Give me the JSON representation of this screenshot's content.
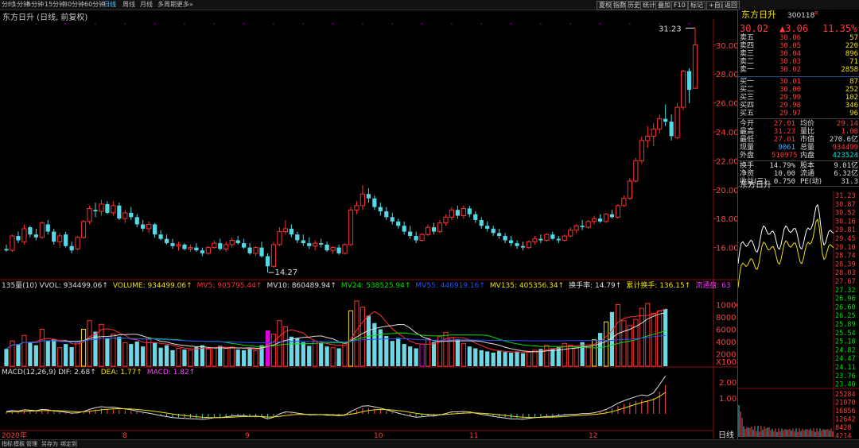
{
  "toolbar": {
    "tabs": [
      "分时",
      "1分钟",
      "5分钟",
      "15分钟",
      "30分钟",
      "60分钟",
      "日线",
      "周线",
      "月线",
      "多周期",
      "更多»"
    ],
    "selected": "日线",
    "right_buttons": [
      "夏权",
      "指数",
      "历史",
      "统计",
      "叠加",
      "F10",
      "标记",
      "+自选",
      "返回"
    ]
  },
  "chart": {
    "title": "东方日升 (日线, 前复权)",
    "max_label": "31.23",
    "min_label": "14.27",
    "price_ticks": [
      "30.00",
      "28.00",
      "26.00",
      "24.00",
      "22.00",
      "20.00",
      "18.00",
      "16.00"
    ],
    "month_labels": [
      "2020年",
      "8",
      "9",
      "10",
      "11",
      "12"
    ],
    "period_label": "日线",
    "vol_unit": "X100",
    "vol_ticks": [
      "10000",
      "8000",
      "6000",
      "4000",
      "2000"
    ],
    "macd_ticks": [
      "2.00",
      "1.00"
    ]
  },
  "vol_info": [
    {
      "text": "135量(10) VVOL: 934499.06↑",
      "color": "#dddddd"
    },
    {
      "text": "VOLUME: 934499.06↑",
      "color": "#f0e000"
    },
    {
      "text": "MV5: 905795.44↑",
      "color": "#ff3030"
    },
    {
      "text": "MV10: 860489.94↑",
      "color": "#dddddd"
    },
    {
      "text": "MV24: 538525.94↑",
      "color": "#00e000"
    },
    {
      "text": "MV55: 446919.16↑",
      "color": "#2050ff"
    },
    {
      "text": "MV135: 405356.34↑",
      "color": "#f0e000"
    },
    {
      "text": "换手率: 14.79↑",
      "color": "#dddddd"
    },
    {
      "text": "累计换手: 136.15↑",
      "color": "#f0e000"
    },
    {
      "text": "流通盘: 63",
      "color": "#ff30ff"
    }
  ],
  "macd_info": [
    {
      "text": "MACD(12,26,9) DIF: 2.68↑",
      "color": "#dddddd"
    },
    {
      "text": "DEA: 1.77↑",
      "color": "#f0e000"
    },
    {
      "text": "MACD: 1.82↑",
      "color": "#ff40ff"
    }
  ],
  "quote": {
    "name": "东方日升",
    "code": "300118",
    "badge": "R",
    "price": "30.02",
    "change": "▲3.06",
    "pct": "11.35%",
    "asks": [
      {
        "label": "卖五",
        "price": "30.06",
        "vol": "57"
      },
      {
        "label": "卖四",
        "price": "30.05",
        "vol": "220"
      },
      {
        "label": "卖三",
        "price": "30.04",
        "vol": "896"
      },
      {
        "label": "卖二",
        "price": "30.03",
        "vol": "71"
      },
      {
        "label": "卖一",
        "price": "30.02",
        "vol": "2858"
      }
    ],
    "bids": [
      {
        "label": "买一",
        "price": "30.01",
        "vol": "87"
      },
      {
        "label": "买二",
        "price": "30.00",
        "vol": "252"
      },
      {
        "label": "买三",
        "price": "29.99",
        "vol": "102"
      },
      {
        "label": "买四",
        "price": "29.98",
        "vol": "346"
      },
      {
        "label": "买五",
        "price": "29.97",
        "vol": "96"
      }
    ],
    "stats": [
      {
        "l1": "今开",
        "v1": "27.01",
        "l2": "均价",
        "v2": "29.14"
      },
      {
        "l1": "最高",
        "v1": "31.23",
        "l2": "量比",
        "v2": "1.08"
      },
      {
        "l1": "最低",
        "v1": "27.01",
        "l2": "市值",
        "v2": "270.6亿"
      },
      {
        "l1": "现量",
        "v1": "9061",
        "l2": "总量",
        "v2": "934499"
      },
      {
        "l1": "外盘",
        "v1": "510975",
        "l2": "内盘",
        "v2": "423524"
      }
    ],
    "stats2": [
      {
        "l1": "换手",
        "v1": "14.79%",
        "l2": "股本",
        "v2": "9.01亿"
      },
      {
        "l1": "净资",
        "v1": "10.00",
        "l2": "流通",
        "v2": "6.32亿"
      },
      {
        "l1": "收益(三)",
        "v1": "0.750",
        "l2": "PE(动)",
        "v2": "31.3"
      }
    ],
    "mini_title": "东方日升",
    "mini_price_ticks": [
      "31.23",
      "30.87",
      "30.52",
      "30.16",
      "29.81",
      "29.45",
      "29.10",
      "28.74",
      "28.39",
      "28.03",
      "27.67",
      "27.32",
      "26.96",
      "26.60",
      "26.25",
      "25.89",
      "25.54",
      "25.18",
      "24.82",
      "24.47",
      "24.11",
      "23.76",
      "23.40"
    ],
    "mini_vol_ticks": [
      "25284",
      "21070",
      "16856",
      "12642",
      "8428",
      "4214"
    ]
  },
  "bottombar": {
    "tabs": [
      "指标",
      "模板",
      "管理",
      "另存为",
      "绑定到"
    ]
  },
  "chart_data": {
    "type": "candlestick",
    "title": "东方日升 (日线, 前复权)",
    "ylim": [
      14.0,
      31.8
    ],
    "months": [
      "2020年",
      "8",
      "9",
      "10",
      "11",
      "12"
    ],
    "ohlc": [
      [
        15.9,
        16.2,
        15.7,
        15.8
      ],
      [
        15.8,
        16.9,
        15.7,
        16.8
      ],
      [
        16.8,
        17.1,
        16.3,
        16.5
      ],
      [
        16.4,
        17.6,
        16.2,
        17.3
      ],
      [
        17.4,
        17.5,
        16.7,
        16.9
      ],
      [
        16.9,
        17.3,
        16.5,
        16.7
      ],
      [
        16.7,
        17.8,
        16.6,
        17.7
      ],
      [
        17.6,
        17.9,
        16.9,
        17.1
      ],
      [
        17.1,
        17.3,
        16.2,
        16.4
      ],
      [
        16.4,
        17.0,
        16.0,
        16.8
      ],
      [
        16.9,
        17.1,
        16.0,
        16.1
      ],
      [
        16.1,
        16.4,
        15.6,
        15.8
      ],
      [
        15.9,
        16.8,
        15.8,
        16.7
      ],
      [
        16.7,
        17.9,
        16.6,
        17.8
      ],
      [
        17.8,
        18.9,
        17.6,
        18.7
      ],
      [
        18.6,
        19.1,
        18.1,
        18.5
      ],
      [
        18.5,
        19.3,
        18.2,
        19.0
      ],
      [
        19.0,
        19.2,
        18.3,
        18.4
      ],
      [
        18.4,
        19.2,
        18.2,
        18.9
      ],
      [
        18.9,
        19.1,
        17.9,
        18.0
      ],
      [
        18.0,
        18.6,
        17.7,
        18.4
      ],
      [
        18.4,
        18.8,
        17.9,
        18.1
      ],
      [
        18.1,
        18.3,
        17.4,
        17.6
      ],
      [
        17.6,
        17.9,
        17.1,
        17.3
      ],
      [
        17.3,
        17.8,
        17.0,
        17.6
      ],
      [
        17.6,
        17.7,
        16.7,
        16.9
      ],
      [
        16.9,
        17.2,
        16.5,
        16.6
      ],
      [
        16.6,
        16.9,
        16.2,
        16.3
      ],
      [
        16.3,
        16.6,
        15.9,
        16.1
      ],
      [
        16.1,
        16.4,
        15.8,
        16.2
      ],
      [
        16.2,
        16.3,
        15.8,
        15.9
      ],
      [
        15.9,
        16.2,
        15.7,
        16.0
      ],
      [
        16.0,
        16.3,
        15.7,
        15.8
      ],
      [
        15.8,
        16.0,
        15.4,
        15.6
      ],
      [
        15.6,
        16.1,
        15.5,
        16.0
      ],
      [
        16.0,
        16.5,
        15.9,
        16.3
      ],
      [
        16.3,
        16.6,
        15.8,
        15.9
      ],
      [
        15.9,
        16.4,
        15.7,
        16.2
      ],
      [
        16.2,
        16.7,
        16.0,
        16.5
      ],
      [
        16.5,
        16.8,
        16.2,
        16.3
      ],
      [
        16.3,
        16.6,
        15.9,
        16.0
      ],
      [
        16.0,
        16.3,
        15.5,
        15.6
      ],
      [
        15.6,
        16.1,
        15.4,
        16.0
      ],
      [
        16.0,
        16.4,
        15.3,
        15.4
      ],
      [
        15.4,
        15.6,
        14.27,
        14.7
      ],
      [
        14.7,
        16.4,
        14.6,
        16.2
      ],
      [
        16.2,
        17.4,
        16.1,
        17.1
      ],
      [
        17.1,
        17.9,
        16.9,
        17.3
      ],
      [
        17.3,
        17.6,
        16.7,
        16.9
      ],
      [
        16.9,
        17.1,
        16.3,
        16.5
      ],
      [
        16.5,
        16.9,
        16.1,
        16.3
      ],
      [
        16.3,
        16.7,
        15.9,
        16.1
      ],
      [
        16.1,
        16.5,
        15.8,
        16.3
      ],
      [
        16.3,
        16.6,
        16.0,
        16.2
      ],
      [
        16.2,
        16.4,
        15.7,
        15.8
      ],
      [
        15.8,
        16.1,
        15.6,
        16.0
      ],
      [
        16.0,
        16.2,
        15.5,
        15.6
      ],
      [
        15.6,
        16.3,
        15.5,
        16.2
      ],
      [
        16.2,
        18.8,
        16.1,
        18.6
      ],
      [
        18.6,
        19.2,
        18.3,
        18.9
      ],
      [
        18.9,
        20.3,
        18.6,
        19.7
      ],
      [
        19.7,
        20.1,
        19.1,
        19.4
      ],
      [
        19.4,
        19.6,
        18.6,
        18.8
      ],
      [
        18.8,
        19.1,
        18.2,
        18.5
      ],
      [
        18.5,
        18.8,
        17.9,
        18.1
      ],
      [
        18.1,
        18.4,
        17.6,
        17.8
      ],
      [
        17.8,
        18.0,
        17.3,
        17.5
      ],
      [
        17.5,
        17.8,
        16.9,
        17.1
      ],
      [
        17.1,
        17.5,
        16.6,
        16.8
      ],
      [
        16.8,
        17.1,
        16.3,
        16.5
      ],
      [
        16.5,
        17.0,
        16.4,
        16.9
      ],
      [
        16.9,
        17.6,
        16.8,
        17.4
      ],
      [
        17.4,
        17.7,
        16.9,
        17.1
      ],
      [
        17.1,
        17.9,
        17.0,
        17.7
      ],
      [
        17.7,
        18.3,
        17.5,
        18.1
      ],
      [
        18.1,
        18.8,
        17.9,
        18.6
      ],
      [
        18.6,
        18.9,
        18.0,
        18.2
      ],
      [
        18.2,
        18.9,
        18.0,
        18.7
      ],
      [
        18.7,
        18.9,
        18.1,
        18.3
      ],
      [
        18.3,
        18.5,
        17.7,
        17.9
      ],
      [
        17.9,
        18.1,
        17.3,
        17.5
      ],
      [
        17.5,
        17.8,
        17.1,
        17.3
      ],
      [
        17.3,
        17.5,
        16.8,
        17.0
      ],
      [
        17.0,
        17.3,
        16.6,
        16.8
      ],
      [
        16.8,
        17.0,
        16.3,
        16.5
      ],
      [
        16.5,
        16.8,
        16.1,
        16.3
      ],
      [
        16.3,
        16.5,
        15.9,
        16.1
      ],
      [
        16.1,
        16.4,
        15.8,
        16.0
      ],
      [
        16.0,
        16.5,
        15.9,
        16.4
      ],
      [
        16.4,
        16.8,
        16.2,
        16.6
      ],
      [
        16.6,
        16.9,
        16.3,
        16.5
      ],
      [
        16.5,
        17.0,
        16.4,
        16.9
      ],
      [
        16.9,
        17.1,
        16.5,
        16.6
      ],
      [
        16.6,
        16.8,
        16.3,
        16.5
      ],
      [
        16.5,
        16.9,
        16.4,
        16.8
      ],
      [
        16.8,
        17.4,
        16.7,
        17.2
      ],
      [
        17.2,
        17.6,
        17.0,
        17.5
      ],
      [
        17.5,
        17.9,
        17.2,
        17.4
      ],
      [
        17.4,
        17.9,
        17.3,
        17.8
      ],
      [
        17.8,
        18.2,
        17.6,
        18.0
      ],
      [
        18.0,
        18.3,
        17.7,
        17.8
      ],
      [
        17.8,
        18.4,
        17.7,
        18.3
      ],
      [
        18.3,
        18.6,
        18.0,
        18.1
      ],
      [
        18.1,
        19.0,
        18.0,
        18.9
      ],
      [
        18.9,
        19.6,
        18.8,
        19.4
      ],
      [
        19.4,
        20.8,
        19.3,
        20.6
      ],
      [
        20.6,
        22.2,
        20.5,
        22.0
      ],
      [
        22.0,
        23.7,
        21.8,
        23.4
      ],
      [
        23.4,
        24.4,
        22.9,
        23.7
      ],
      [
        23.7,
        24.6,
        23.0,
        24.2
      ],
      [
        24.2,
        25.2,
        23.9,
        24.9
      ],
      [
        24.9,
        25.9,
        24.4,
        24.7
      ],
      [
        24.7,
        25.2,
        23.4,
        23.7
      ],
      [
        23.6,
        26.0,
        23.5,
        25.7
      ],
      [
        25.7,
        28.3,
        25.5,
        28.2
      ],
      [
        28.2,
        28.4,
        26.0,
        26.9
      ],
      [
        27.01,
        31.23,
        27.01,
        30.02
      ]
    ],
    "volume": [
      2.8,
      4.1,
      3.6,
      5.0,
      3.9,
      3.4,
      6.0,
      4.2,
      4.4,
      3.0,
      3.6,
      3.1,
      3.9,
      6.0,
      7.4,
      5.6,
      6.8,
      4.6,
      5.2,
      4.8,
      3.8,
      3.6,
      4.0,
      3.2,
      4.4,
      3.9,
      3.0,
      3.4,
      2.6,
      2.9,
      2.7,
      2.6,
      3.1,
      3.4,
      2.8,
      3.0,
      3.3,
      2.9,
      3.1,
      2.7,
      2.6,
      2.9,
      2.5,
      3.4,
      5.8,
      5.2,
      7.4,
      6.4,
      4.8,
      4.5,
      3.9,
      3.3,
      4.1,
      3.8,
      3.2,
      3.0,
      2.9,
      3.7,
      9.0,
      10.6,
      9.6,
      8.2,
      7.0,
      6.0,
      4.9,
      4.1,
      4.6,
      3.6,
      3.2,
      2.9,
      3.6,
      4.5,
      3.9,
      4.8,
      5.5,
      4.6,
      4.4,
      3.7,
      3.2,
      2.9,
      2.6,
      2.4,
      2.2,
      2.5,
      2.3,
      2.2,
      2.4,
      2.1,
      2.3,
      2.6,
      2.8,
      3.4,
      2.9,
      3.1,
      3.7,
      3.4,
      3.1,
      3.9,
      3.2,
      4.3,
      5.4,
      7.2,
      8.8,
      10.0,
      7.4,
      6.6,
      7.6,
      9.4,
      10.2,
      8.6,
      9.0,
      9.3
    ],
    "volume_unit": "X100",
    "macd": [
      0.1,
      0.15,
      0.12,
      0.18,
      0.16,
      0.14,
      0.2,
      0.18,
      0.12,
      0.1,
      0.06,
      0.02,
      0.03,
      0.1,
      0.2,
      0.28,
      0.33,
      0.3,
      0.31,
      0.26,
      0.22,
      0.18,
      0.12,
      0.06,
      0.02,
      -0.04,
      -0.1,
      -0.15,
      -0.2,
      -0.22,
      -0.24,
      -0.25,
      -0.26,
      -0.28,
      -0.25,
      -0.2,
      -0.2,
      -0.16,
      -0.12,
      -0.1,
      -0.1,
      -0.14,
      -0.12,
      -0.16,
      -0.26,
      -0.18,
      -0.02,
      0.08,
      0.06,
      0.02,
      -0.02,
      -0.06,
      -0.06,
      -0.05,
      -0.08,
      -0.08,
      -0.1,
      -0.08,
      0.1,
      0.24,
      0.36,
      0.38,
      0.32,
      0.26,
      0.18,
      0.1,
      0.02,
      -0.06,
      -0.12,
      -0.18,
      -0.16,
      -0.12,
      -0.12,
      -0.06,
      0.0,
      0.08,
      0.08,
      0.1,
      0.08,
      0.02,
      -0.04,
      -0.08,
      -0.14,
      -0.18,
      -0.22,
      -0.26,
      -0.26,
      -0.28,
      -0.24,
      -0.2,
      -0.18,
      -0.14,
      -0.14,
      -0.1,
      -0.06,
      -0.04,
      -0.04,
      0.0,
      0.0,
      0.04,
      0.1,
      0.2,
      0.34,
      0.5,
      0.62,
      0.72,
      0.82,
      0.9,
      0.86,
      1.0,
      1.4,
      1.82
    ]
  }
}
